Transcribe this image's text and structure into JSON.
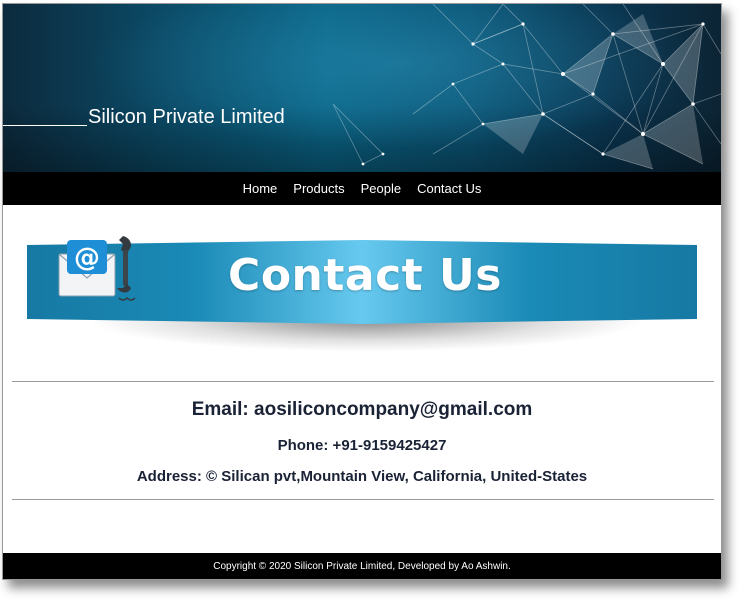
{
  "header": {
    "brand": "Silicon Private Limited"
  },
  "nav": {
    "items": [
      {
        "label": "Home"
      },
      {
        "label": "Products"
      },
      {
        "label": "People"
      },
      {
        "label": "Contact Us"
      }
    ]
  },
  "banner": {
    "title": "Contact Us",
    "icons": [
      "email-icon",
      "phone-icon"
    ]
  },
  "contact": {
    "email": "Email: aosiliconcompany@gmail.com",
    "phone": "Phone: +91-9159425427",
    "address": "Address: © Silican pvt,Mountain View, California, United-States"
  },
  "footer": {
    "text": "Copyright © 2020 Silicon Private Limited, Developed by Ao Ashwin."
  },
  "colors": {
    "banner_blue": "#0a6486",
    "ribbon_blue": "#1a8ab6",
    "nav_bg": "#000000",
    "text_dark": "#1a2235"
  }
}
